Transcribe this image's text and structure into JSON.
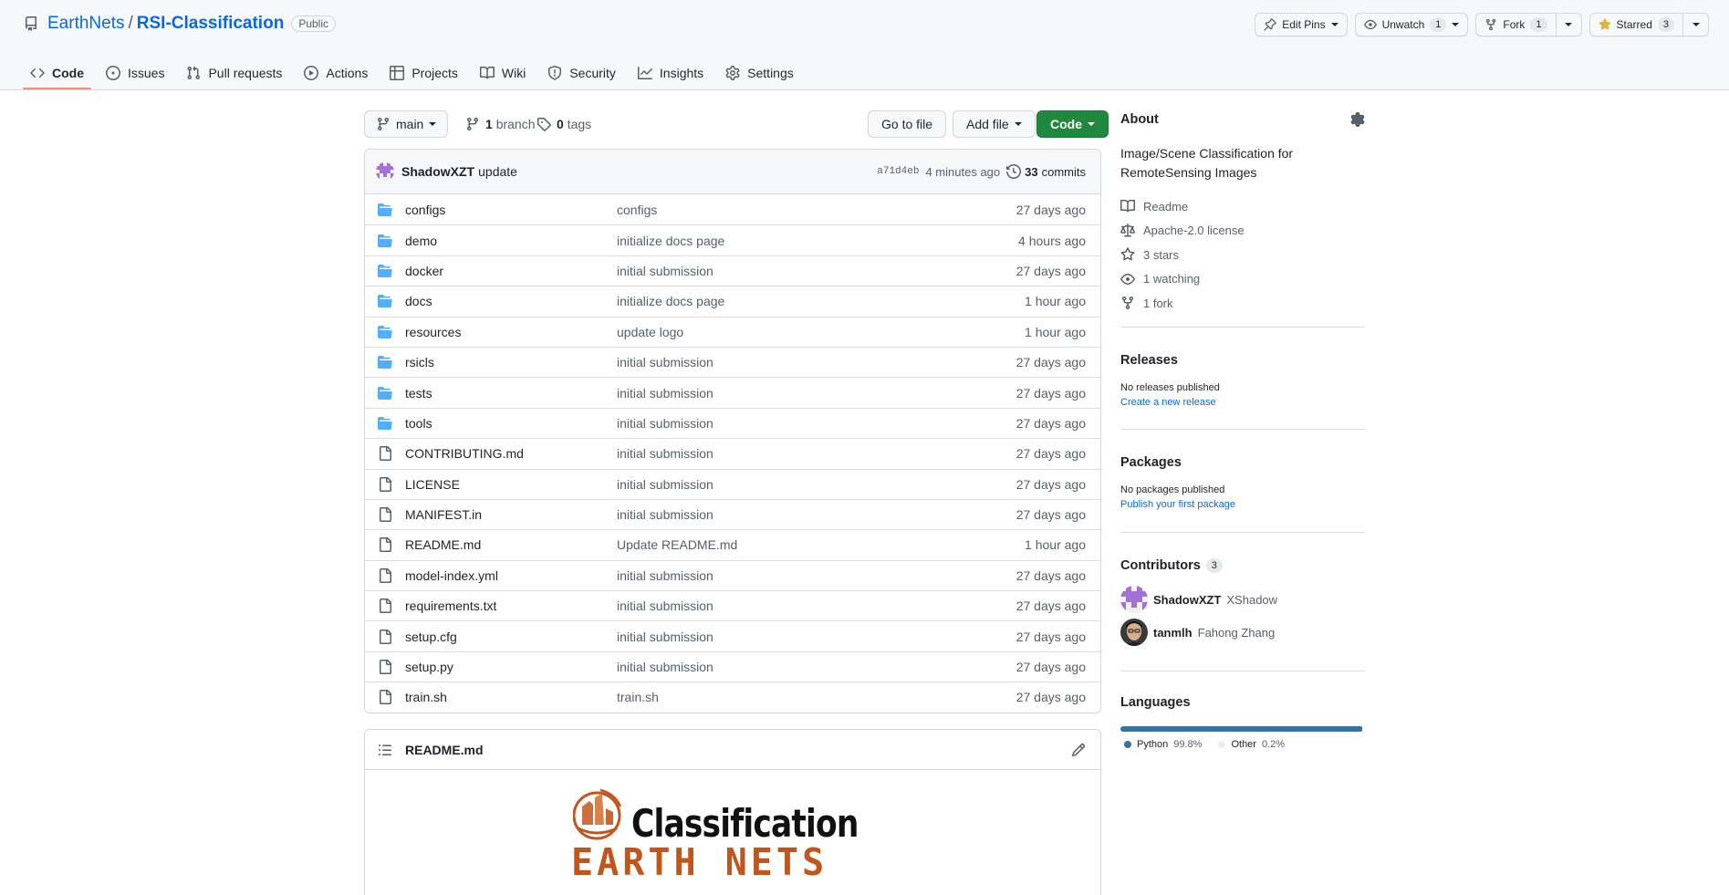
{
  "repo": {
    "owner": "EarthNets",
    "separator": "/",
    "name": "RSI-Classification",
    "visibility": "Public"
  },
  "header_actions": {
    "edit_pins": "Edit Pins",
    "unwatch": "Unwatch",
    "unwatch_count": "1",
    "fork": "Fork",
    "fork_count": "1",
    "starred": "Starred",
    "star_count": "3"
  },
  "tabs": [
    {
      "label": "Code",
      "icon": "code-icon",
      "active": true
    },
    {
      "label": "Issues",
      "icon": "issue-icon"
    },
    {
      "label": "Pull requests",
      "icon": "pull-request-icon"
    },
    {
      "label": "Actions",
      "icon": "play-icon"
    },
    {
      "label": "Projects",
      "icon": "table-icon"
    },
    {
      "label": "Wiki",
      "icon": "book-icon"
    },
    {
      "label": "Security",
      "icon": "shield-icon"
    },
    {
      "label": "Insights",
      "icon": "graph-icon"
    },
    {
      "label": "Settings",
      "icon": "gear-icon"
    }
  ],
  "toolbar": {
    "branch": "main",
    "branch_count": "1",
    "branch_label": "branch",
    "tag_count": "0",
    "tag_label": "tags",
    "go_to_file": "Go to file",
    "add_file": "Add file",
    "code": "Code"
  },
  "commit": {
    "author": "ShadowXZT",
    "message": "update",
    "sha": "a71d4eb",
    "time": "4 minutes ago",
    "count": "33",
    "count_label": "commits"
  },
  "files": [
    {
      "type": "dir",
      "name": "configs",
      "message": "configs",
      "age": "27 days ago"
    },
    {
      "type": "dir",
      "name": "demo",
      "message": "initialize docs page",
      "age": "4 hours ago"
    },
    {
      "type": "dir",
      "name": "docker",
      "message": "initial submission",
      "age": "27 days ago"
    },
    {
      "type": "dir",
      "name": "docs",
      "message": "initialize docs page",
      "age": "1 hour ago"
    },
    {
      "type": "dir",
      "name": "resources",
      "message": "update logo",
      "age": "1 hour ago"
    },
    {
      "type": "dir",
      "name": "rsicls",
      "message": "initial submission",
      "age": "27 days ago"
    },
    {
      "type": "dir",
      "name": "tests",
      "message": "initial submission",
      "age": "27 days ago"
    },
    {
      "type": "dir",
      "name": "tools",
      "message": "initial submission",
      "age": "27 days ago"
    },
    {
      "type": "file",
      "name": "CONTRIBUTING.md",
      "message": "initial submission",
      "age": "27 days ago"
    },
    {
      "type": "file",
      "name": "LICENSE",
      "message": "initial submission",
      "age": "27 days ago"
    },
    {
      "type": "file",
      "name": "MANIFEST.in",
      "message": "initial submission",
      "age": "27 days ago"
    },
    {
      "type": "file",
      "name": "README.md",
      "message": "Update README.md",
      "age": "1 hour ago"
    },
    {
      "type": "file",
      "name": "model-index.yml",
      "message": "initial submission",
      "age": "27 days ago"
    },
    {
      "type": "file",
      "name": "requirements.txt",
      "message": "initial submission",
      "age": "27 days ago"
    },
    {
      "type": "file",
      "name": "setup.cfg",
      "message": "initial submission",
      "age": "27 days ago"
    },
    {
      "type": "file",
      "name": "setup.py",
      "message": "initial submission",
      "age": "27 days ago"
    },
    {
      "type": "file",
      "name": "train.sh",
      "message": "train.sh",
      "age": "27 days ago"
    }
  ],
  "readme": {
    "title": "README.md",
    "logo_top": "Classification",
    "logo_bottom": "EARTH NETS"
  },
  "about": {
    "title": "About",
    "description": "Image/Scene Classification for RemoteSensing Images",
    "items": [
      {
        "label": "Readme",
        "icon": "book-icon"
      },
      {
        "label": "Apache-2.0 license",
        "icon": "law-icon"
      },
      {
        "label": "3 stars",
        "icon": "star-icon"
      },
      {
        "label": "1 watching",
        "icon": "eye-icon"
      },
      {
        "label": "1 fork",
        "icon": "fork-icon"
      }
    ]
  },
  "releases": {
    "title": "Releases",
    "empty": "No releases published",
    "link": "Create a new release"
  },
  "packages": {
    "title": "Packages",
    "empty": "No packages published",
    "link": "Publish your first package"
  },
  "contributors": {
    "title": "Contributors",
    "count": "3",
    "list": [
      {
        "login": "ShadowXZT",
        "name": "XShadow"
      },
      {
        "login": "tanmlh",
        "name": "Fahong Zhang"
      }
    ]
  },
  "languages": {
    "title": "Languages",
    "list": [
      {
        "name": "Python",
        "percent": "99.8%",
        "share": 99.8,
        "color": "#3572A5"
      },
      {
        "name": "Other",
        "percent": "0.2%",
        "share": 0.2,
        "color": "#ededed"
      }
    ]
  },
  "colors": {
    "link": "#0969da",
    "folder": "#54aeff",
    "green_button": "#1f883d",
    "tab_underline": "#fd8c73",
    "star": "#e3b341"
  }
}
